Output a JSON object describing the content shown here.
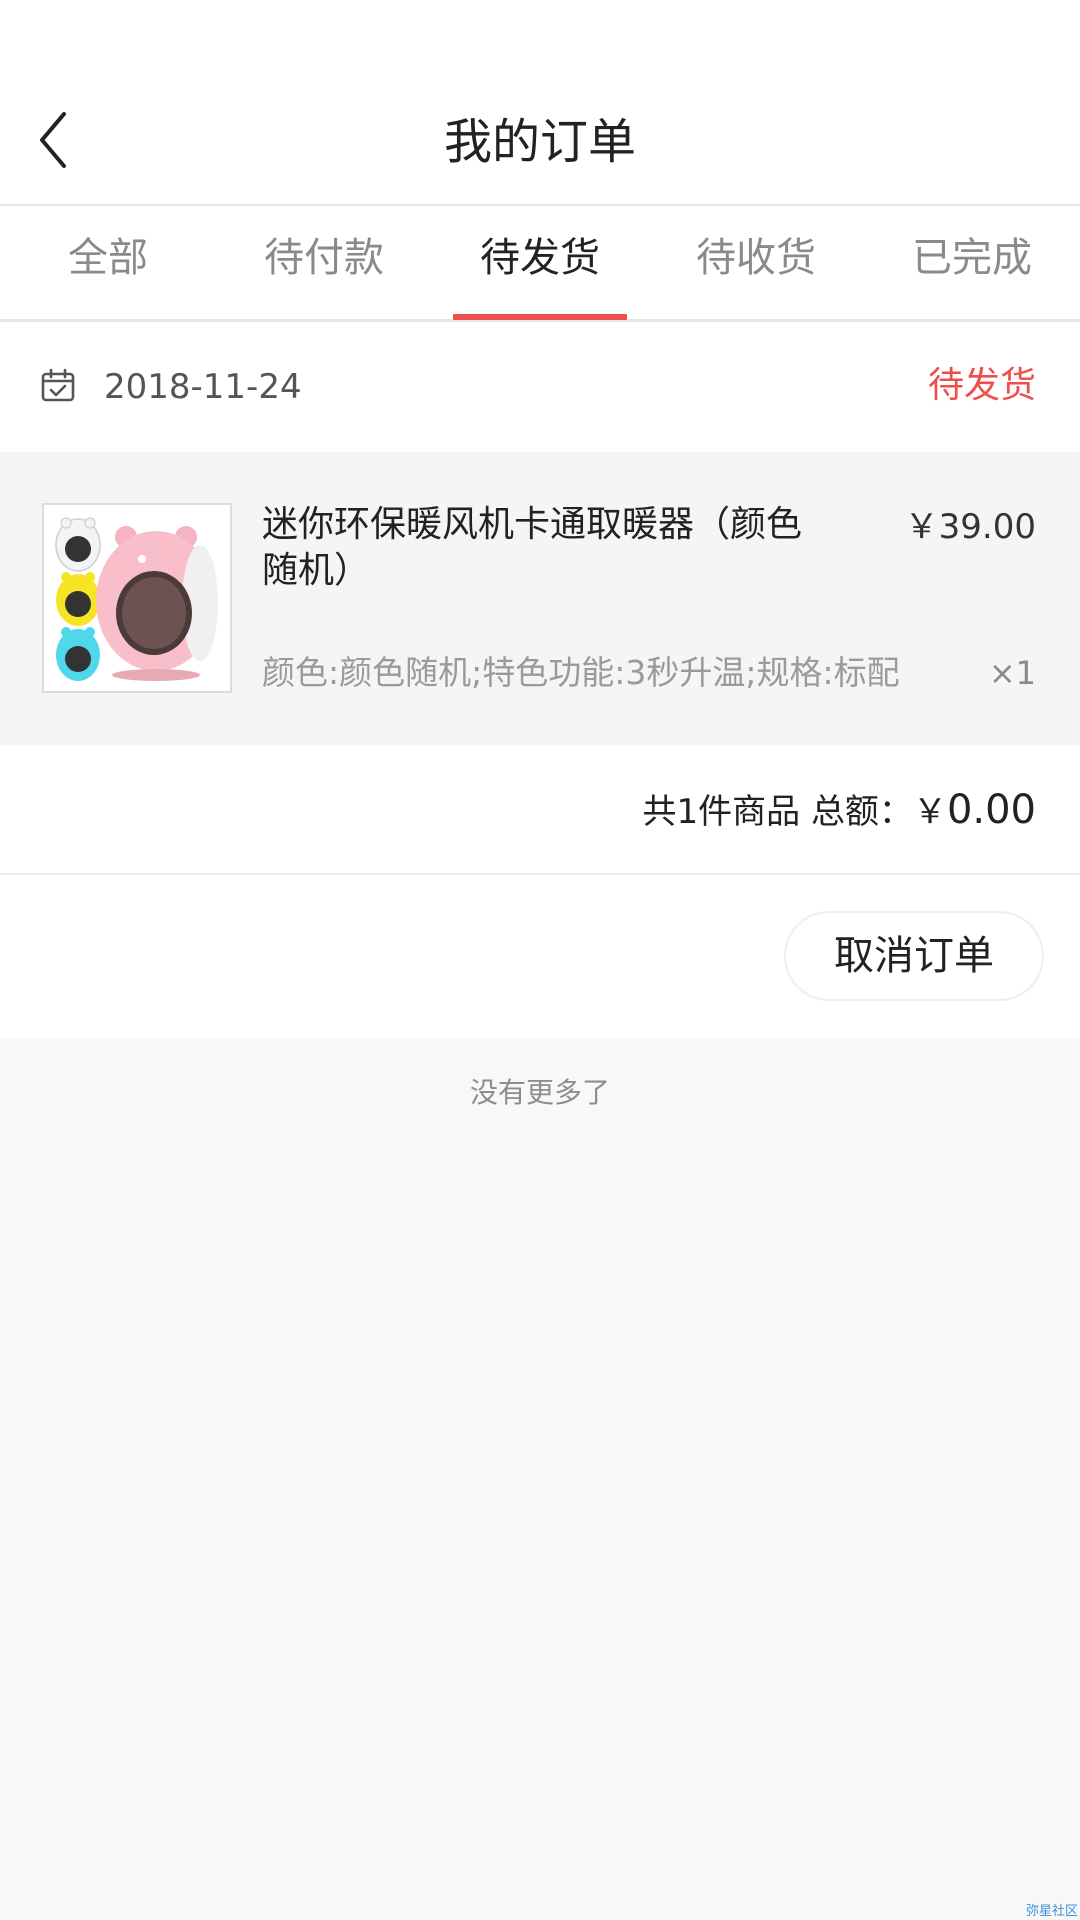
{
  "header": {
    "title": "我的订单"
  },
  "tabs": [
    {
      "label": "全部"
    },
    {
      "label": "待付款"
    },
    {
      "label": "待发货"
    },
    {
      "label": "待收货"
    },
    {
      "label": "已完成"
    }
  ],
  "active_tab": 2,
  "order": {
    "date": "2018-11-24",
    "status": "待发货",
    "item": {
      "name": "迷你环保暖风机卡通取暖器（颜色随机）",
      "price": "￥39.00",
      "spec": "颜色:颜色随机;特色功能:3秒升温;规格:标配",
      "quantity": "×1"
    },
    "summary": {
      "count_text": "共1件商品",
      "total_label": "总额：",
      "currency": "￥",
      "total": "0.00"
    },
    "cancel_label": "取消订单"
  },
  "footer": {
    "no_more": "没有更多了"
  },
  "watermark": "弥星社区",
  "colors": {
    "accent": "#ee4f4b",
    "background": "#f8f8f8"
  }
}
